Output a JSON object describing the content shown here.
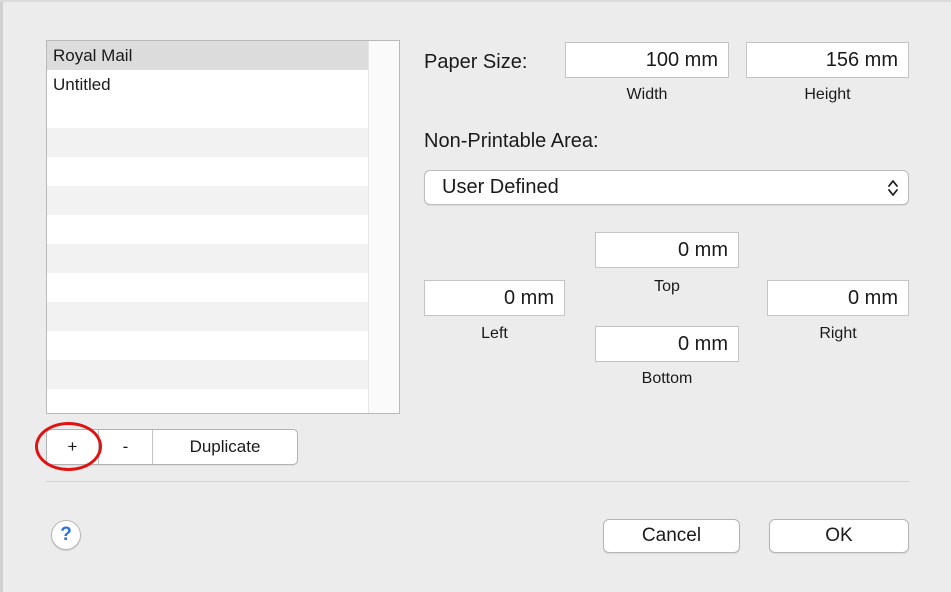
{
  "paper_list": {
    "items": [
      {
        "label": "Royal Mail",
        "selected": true
      },
      {
        "label": "Untitled",
        "selected": false
      }
    ]
  },
  "list_buttons": {
    "add_label": "+",
    "remove_label": "-",
    "duplicate_label": "Duplicate"
  },
  "paper_size": {
    "label": "Paper Size:",
    "width_value": "100 mm",
    "width_caption": "Width",
    "height_value": "156 mm",
    "height_caption": "Height"
  },
  "non_printable": {
    "label": "Non-Printable Area:",
    "selected_option": "User Defined",
    "top_value": "0 mm",
    "top_caption": "Top",
    "left_value": "0 mm",
    "left_caption": "Left",
    "right_value": "0 mm",
    "right_caption": "Right",
    "bottom_value": "0 mm",
    "bottom_caption": "Bottom"
  },
  "footer": {
    "help_label": "?",
    "cancel_label": "Cancel",
    "ok_label": "OK"
  },
  "colors": {
    "highlight_circle": "#e01313",
    "help_icon": "#2a74d8"
  }
}
